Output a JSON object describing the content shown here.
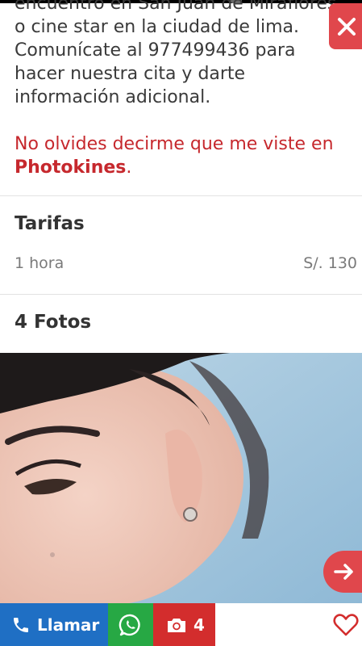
{
  "description_lines": [
    "encuentro en San Juan de Miraflores",
    "o cine star en la ciudad de lima.",
    "Comunícate al 977499436 para",
    "hacer nuestra cita y darte",
    "información adicional."
  ],
  "note": {
    "line1": "No olvides decirme que me viste en",
    "brand": "Photokines",
    "suffix": "."
  },
  "rates": {
    "title": "Tarifas",
    "items": [
      {
        "label": "1 hora",
        "price": "S/. 130"
      }
    ]
  },
  "photos": {
    "title": "4 Fotos"
  },
  "bottom_bar": {
    "call_label": "Llamar",
    "photo_count": "4"
  },
  "colors": {
    "accent_red": "#e0474c",
    "note_red": "#c6282d",
    "call_blue": "#1f6fc4",
    "whatsapp_green": "#27a844",
    "photos_red": "#d32d2d"
  },
  "icons": {
    "close": "close-icon",
    "next": "arrow-right-icon",
    "call": "phone-icon",
    "whatsapp": "whatsapp-icon",
    "camera": "camera-icon",
    "favorite": "heart-icon"
  }
}
